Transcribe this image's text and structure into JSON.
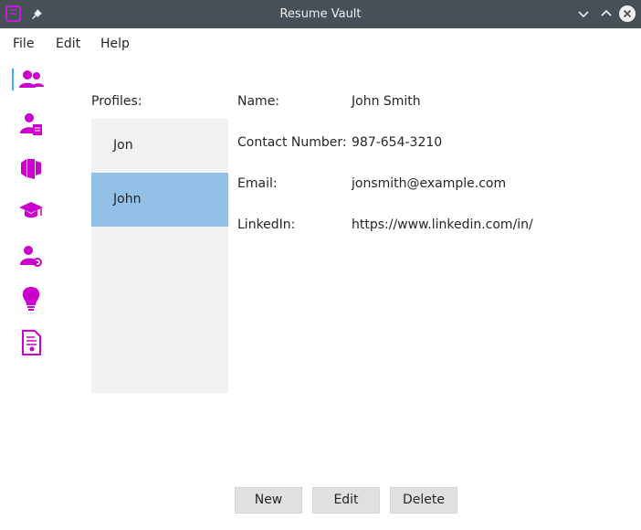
{
  "window": {
    "title": "Resume Vault"
  },
  "menu": {
    "file": "File",
    "edit": "Edit",
    "help": "Help"
  },
  "sidebar": {
    "icons": [
      "profiles-icon",
      "personal-info-icon",
      "experience-icon",
      "education-icon",
      "skills-icon",
      "ideas-icon",
      "documents-icon"
    ],
    "accent_color": "#cc00cc"
  },
  "profiles": {
    "label": "Profiles:",
    "items": [
      {
        "name": "Jon",
        "selected": false
      },
      {
        "name": "John",
        "selected": true
      }
    ]
  },
  "details": {
    "name_label": "Name:",
    "name_value": "John Smith",
    "contact_label": "Contact Number:",
    "contact_value": "987-654-3210",
    "email_label": "Email:",
    "email_value": "jonsmith@example.com",
    "linkedin_label": "LinkedIn:",
    "linkedin_value": "https://www.linkedin.com/in/"
  },
  "buttons": {
    "new": "New",
    "edit": "Edit",
    "delete": "Delete"
  }
}
